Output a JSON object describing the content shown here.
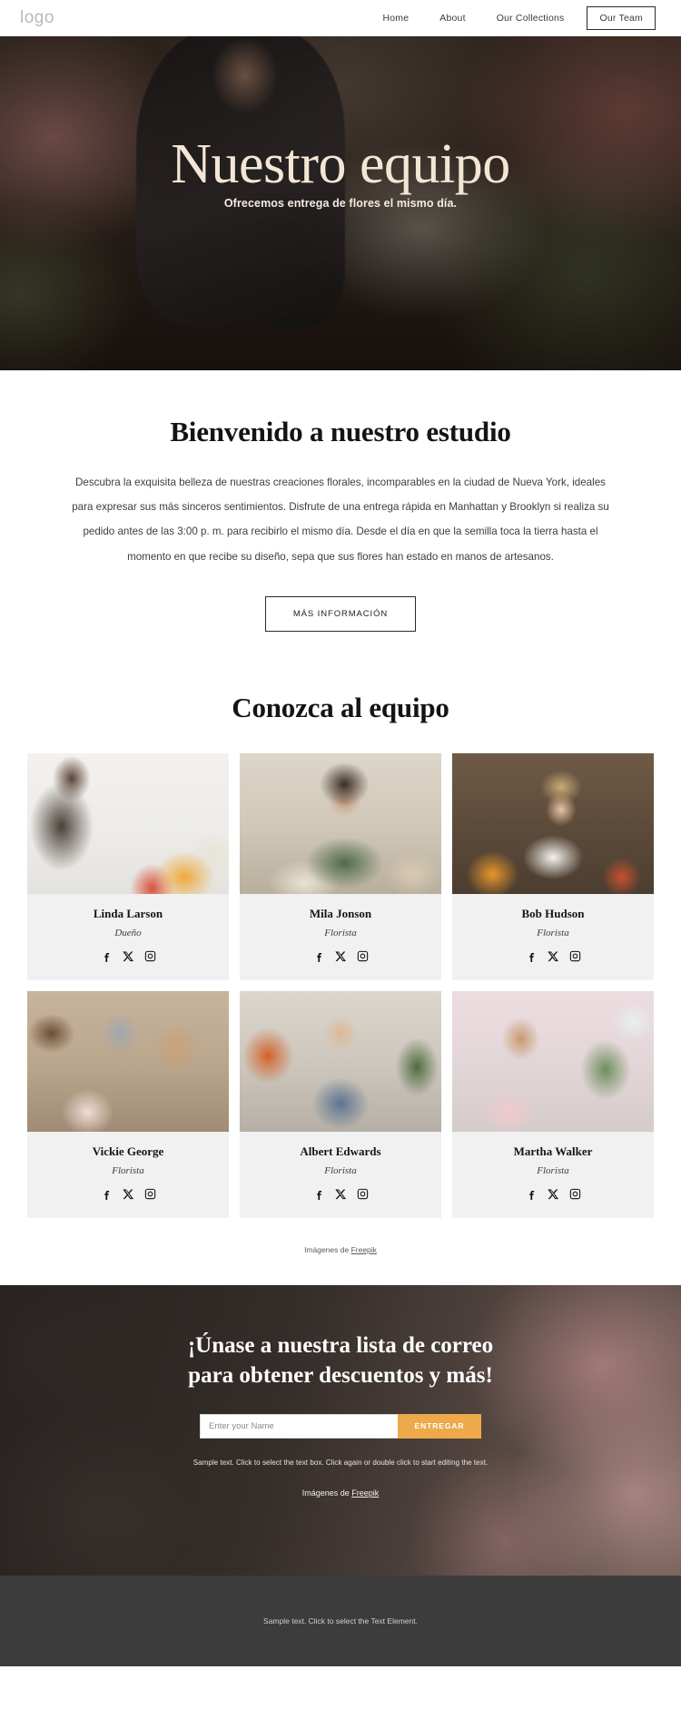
{
  "header": {
    "logo": "logo",
    "nav": [
      {
        "label": "Home",
        "boxed": false
      },
      {
        "label": "About",
        "boxed": false
      },
      {
        "label": "Our Collections",
        "boxed": false
      },
      {
        "label": "Our Team",
        "boxed": true
      }
    ]
  },
  "hero": {
    "title": "Nuestro equipo",
    "subtitle": "Ofrecemos entrega de flores el mismo día."
  },
  "welcome": {
    "title": "Bienvenido a nuestro estudio",
    "body": "Descubra la exquisita belleza de nuestras creaciones florales, incomparables en la ciudad de Nueva York, ideales para expresar sus más sinceros sentimientos. Disfrute de una entrega rápida en Manhattan y Brooklyn si realiza su pedido antes de las 3:00 p. m. para recibirlo el mismo día. Desde el día en que la semilla toca la tierra hasta el momento en que recibe su diseño, sepa que sus flores han estado en manos de artesanos.",
    "button": "MÁS INFORMACIÓN"
  },
  "team": {
    "title": "Conozca al equipo",
    "credit_prefix": "Imágenes de ",
    "credit_link": "Freepik",
    "members": [
      {
        "name": "Linda Larson",
        "role": "Dueño"
      },
      {
        "name": "Mila Jonson",
        "role": "Florista"
      },
      {
        "name": "Bob Hudson",
        "role": "Florista"
      },
      {
        "name": "Vickie George",
        "role": "Florista"
      },
      {
        "name": "Albert Edwards",
        "role": "Florista"
      },
      {
        "name": "Martha Walker",
        "role": "Florista"
      }
    ],
    "social_icons": [
      "facebook-icon",
      "x-twitter-icon",
      "instagram-icon"
    ]
  },
  "newsletter": {
    "title_line1": "¡Únase a nuestra lista de correo",
    "title_line2": "para obtener descuentos y más!",
    "input_placeholder": "Enter your Name",
    "input_value": "",
    "submit_label": "ENTREGAR",
    "note": "Sample text. Click to select the text box. Click again or double click to start editing the text.",
    "credit_prefix": "Imágenes de ",
    "credit_link": "Freepik"
  },
  "footer": {
    "text": "Sample text. Click to select the Text Element."
  },
  "colors": {
    "accent": "#eda94a",
    "hero_title": "#f4e6d5",
    "card_bg": "#f1f1f1",
    "footer_bg": "#3c3c3c"
  }
}
